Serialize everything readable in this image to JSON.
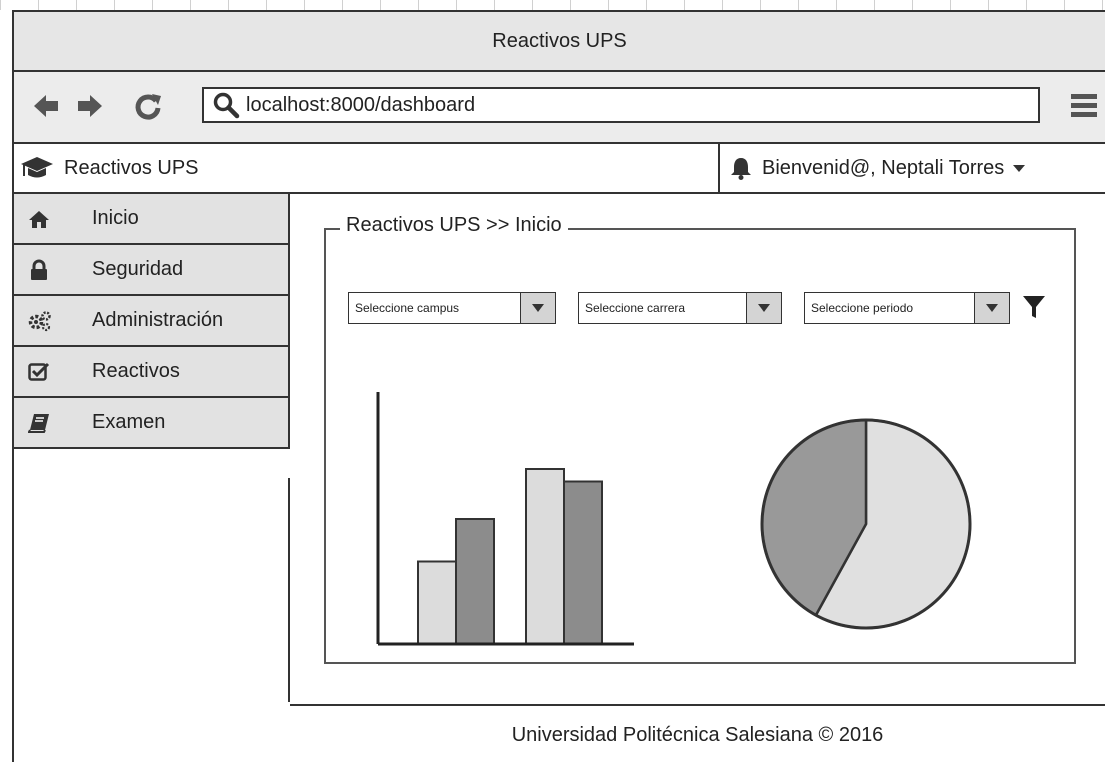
{
  "window": {
    "title": "Reactivos UPS"
  },
  "browser": {
    "url": "localhost:8000/dashboard",
    "icons": [
      "back-arrow-icon",
      "forward-arrow-icon",
      "reload-icon",
      "search-icon",
      "hamburger-menu-icon"
    ]
  },
  "app_header": {
    "brand": "Reactivos UPS",
    "brand_icon": "graduation-cap-icon",
    "welcome": "Bienvenid@, Neptali Torres",
    "bell_icon": "bell-icon"
  },
  "sidebar": {
    "items": [
      {
        "label": "Inicio",
        "icon": "home-icon"
      },
      {
        "label": "Seguridad",
        "icon": "lock-icon"
      },
      {
        "label": "Administración",
        "icon": "gears-icon"
      },
      {
        "label": "Reactivos",
        "icon": "checkbox-icon"
      },
      {
        "label": "Examen",
        "icon": "book-icon"
      }
    ]
  },
  "main": {
    "breadcrumb": "Reactivos UPS >> Inicio",
    "filters": {
      "campus": "Seleccione campus",
      "carrera": "Seleccione carrera",
      "periodo": "Seleccione periodo"
    }
  },
  "chart_data": [
    {
      "type": "bar",
      "categories": [
        "",
        ""
      ],
      "series": [
        {
          "values": [
            0.33,
            0.7
          ]
        },
        {
          "values": [
            0.5,
            0.65
          ]
        }
      ],
      "ylim": [
        0,
        1
      ],
      "colors": [
        "#dcdcdc",
        "#8c8c8c"
      ]
    },
    {
      "type": "pie",
      "values": [
        0.58,
        0.42
      ],
      "colors": [
        "#e0e0e0",
        "#999999"
      ]
    }
  ],
  "footer": {
    "text": "Universidad Politécnica Salesiana © 2016"
  }
}
